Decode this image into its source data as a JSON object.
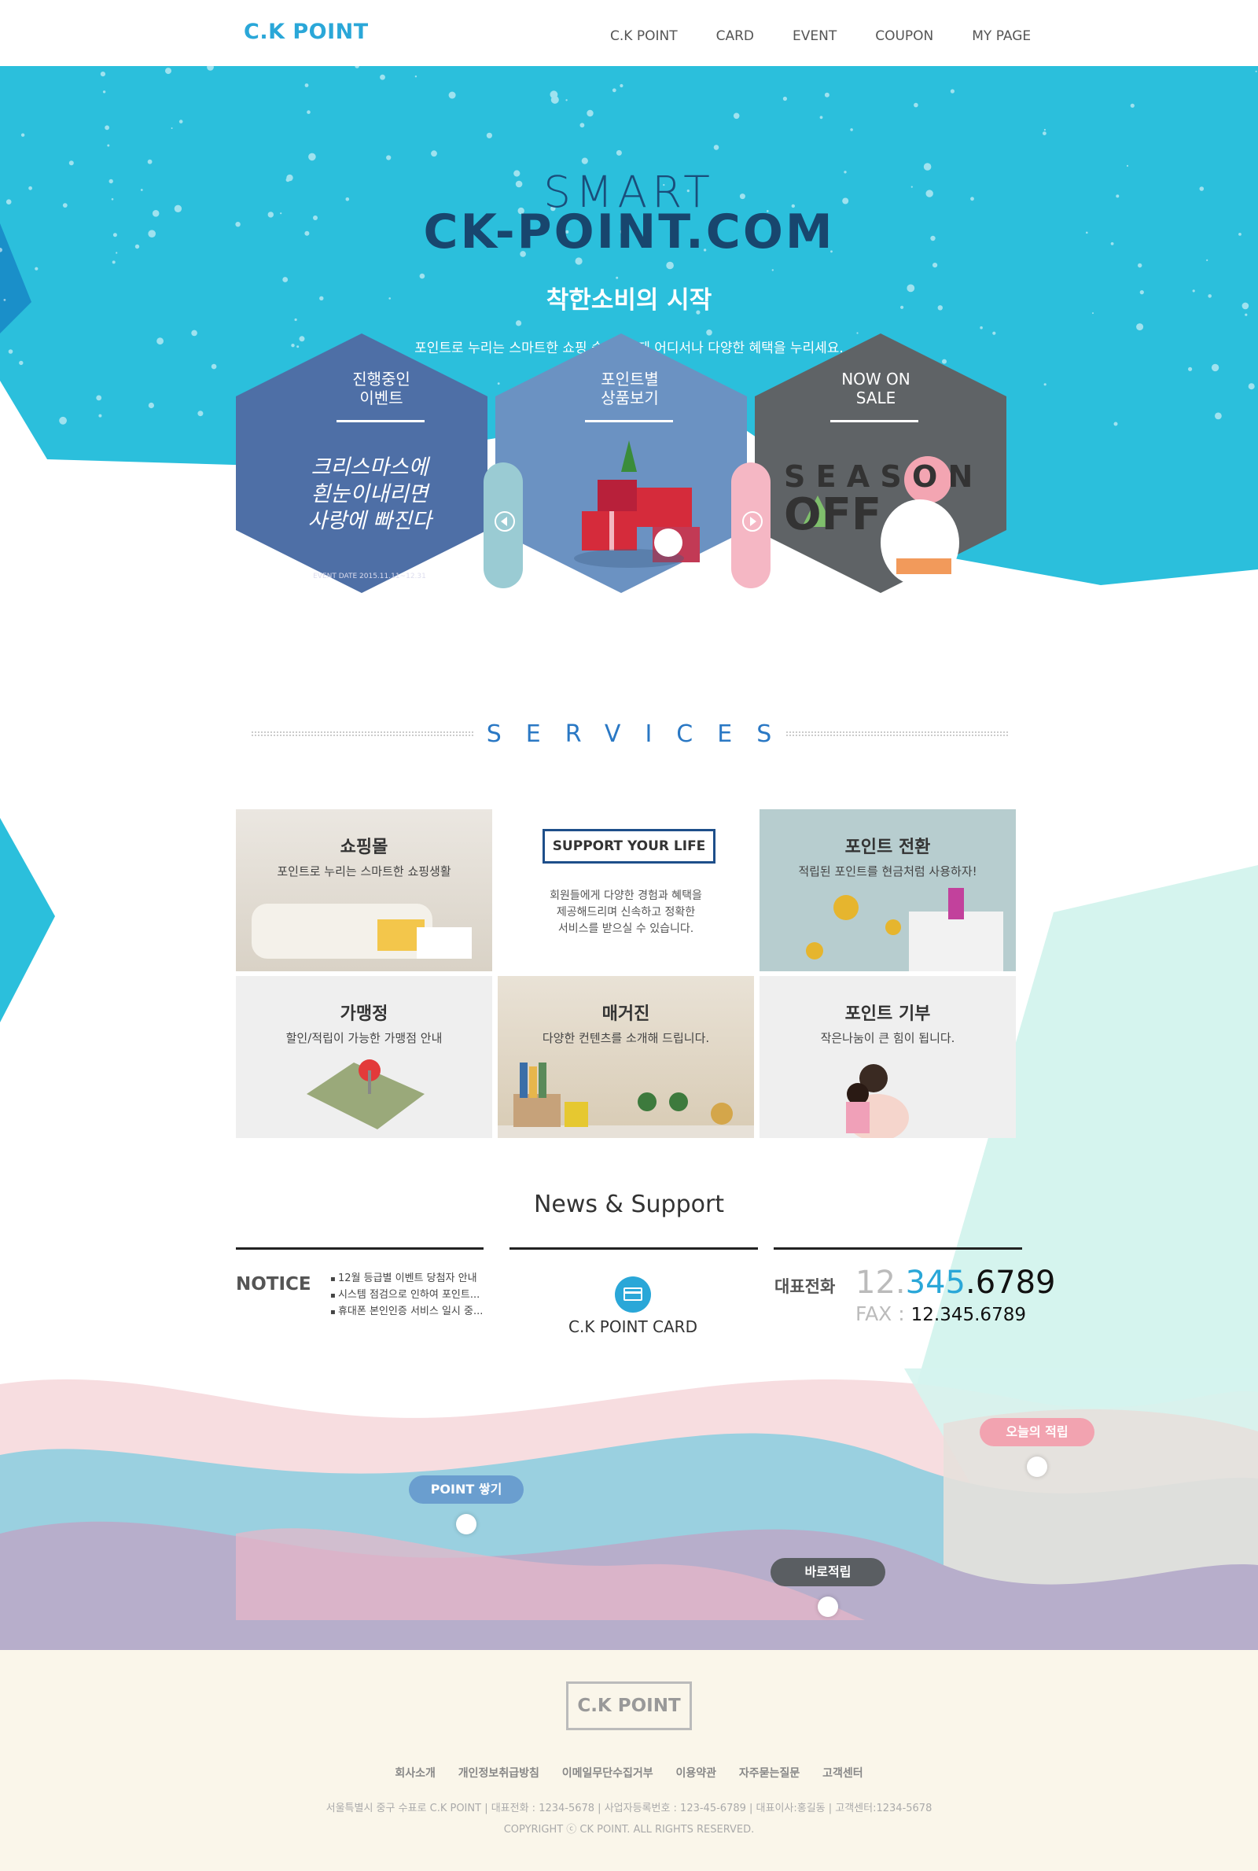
{
  "nav": {
    "logo": "C.K POINT",
    "items": [
      "C.K POINT",
      "CARD",
      "EVENT",
      "COUPON",
      "MY PAGE"
    ]
  },
  "hero": {
    "smart": "SMART",
    "domain": "CK-POINT.COM",
    "headline": "착한소비의 시작",
    "subtext": "포인트로 누리는 스마트한 쇼핑 습관! 언제 어디서나 다양한 혜택을 누리세요.",
    "hexes": [
      {
        "label_line1": "진행중인",
        "label_line2": "이벤트",
        "art_line1": "크리스마스에",
        "art_line2": "흰눈이내리면",
        "art_line3": "사랑에 빠진다",
        "date": "EVENT DATE 2015.11.11~12.31"
      },
      {
        "label_line1": "포인트별",
        "label_line2": "상품보기"
      },
      {
        "label_line1": "NOW ON",
        "label_line2": "SALE",
        "season": "S E A S O N",
        "off": "OFF"
      }
    ]
  },
  "services": {
    "title": "SERVICES",
    "tiles": [
      {
        "title": "쇼핑몰",
        "desc": "포인트로 누리는 스마트한 쇼핑생활"
      },
      {
        "badge": "SUPPORT YOUR LIFE",
        "line1": "회원들에게 다양한 경험과 혜택을",
        "line2": "제공해드리며 신속하고 정확한",
        "line3": "서비스를 받으실 수 있습니다."
      },
      {
        "title": "포인트 전환",
        "desc": "적립된 포인트를 현금처럼 사용하자!"
      },
      {
        "title": "가맹정",
        "desc": "할인/적립이 가능한 가맹점 안내"
      },
      {
        "title": "매거진",
        "desc": "다양한 컨텐츠를 소개해 드립니다."
      },
      {
        "title": "포인트 기부",
        "desc": "작은나눔이 큰 힘이 됩니다."
      }
    ]
  },
  "news": {
    "title": "News & Support",
    "notice_label": "NOTICE",
    "notices": [
      "12월 등급별 이벤트 당첨자 안내",
      "시스템 점검으로 인하여 포인트...",
      "휴대폰 본인인증 서비스 일시 중..."
    ],
    "card_label": "C.K POINT CARD",
    "tel_label": "대표전화",
    "tel_a": "12.",
    "tel_b": "345",
    "tel_c": ".6789",
    "fax_label": "FAX :",
    "fax_value": "12.345.6789"
  },
  "bubbles": {
    "point": "POINT 쌓기",
    "today": "오늘의 적립",
    "direct": "바로적립"
  },
  "footer": {
    "logo": "C.K POINT",
    "links": [
      "회사소개",
      "개인정보취급방침",
      "이메일무단수집거부",
      "이용약관",
      "자주묻는질문",
      "고객센터"
    ],
    "address": "서울특별시 중구 수표로 C.K POINT  |  대표전화 : 1234-5678  |  사업자등록번호 : 123-45-6789  |  대표이사:홍길동  |  고객센터:1234-5678",
    "copyright": "COPYRIGHT ⓒ CK POINT. ALL RIGHTS RESERVED."
  },
  "colors": {
    "brand": "#2aa7d8",
    "hero_bg": "#2bbfdc",
    "services_accent": "#2a78c4",
    "footer_bg": "#faf6ea"
  }
}
